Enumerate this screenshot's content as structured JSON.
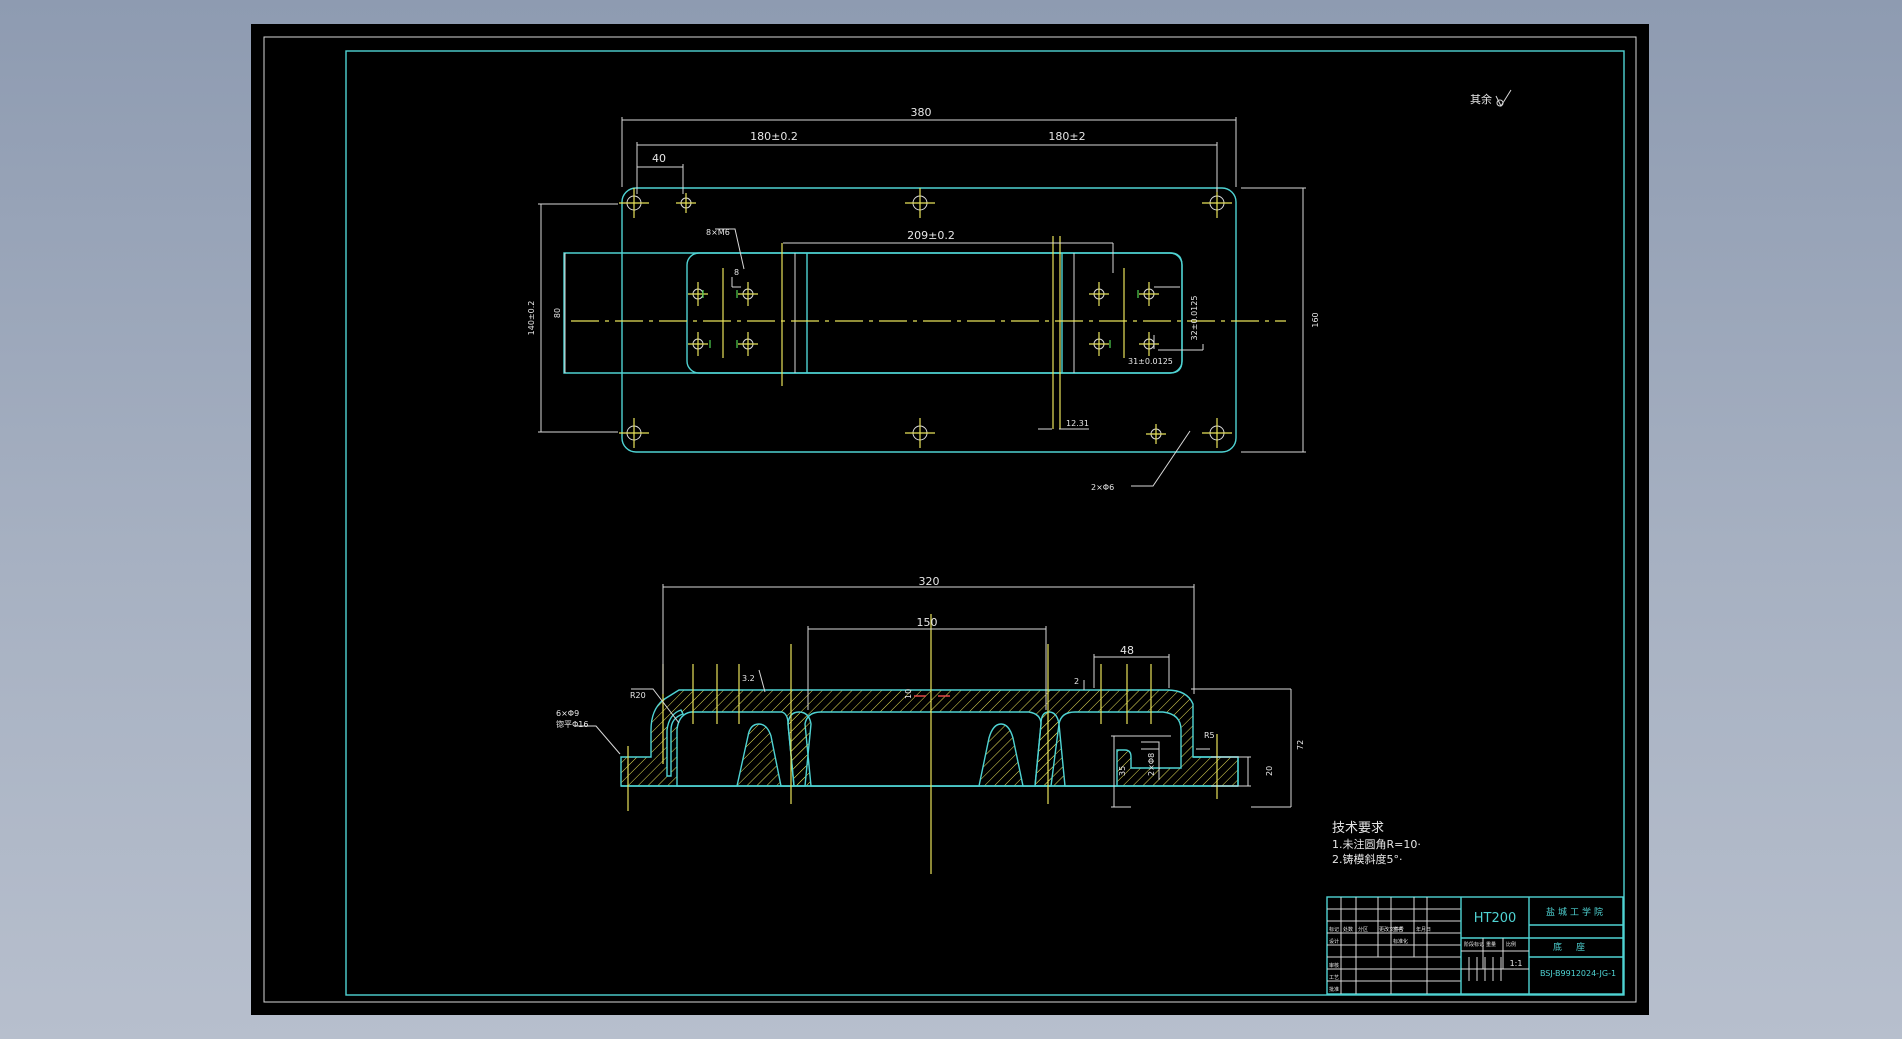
{
  "drawing": {
    "roughness_note": "其余",
    "top_view": {
      "overall_length": "380",
      "half_span_left": "180±0.2",
      "half_span_right": "180±2",
      "hole_offset": "40",
      "slot_span": "209±0.2",
      "thread_callout": "8×M6",
      "small_dim": "8",
      "overall_height": "140±0.2",
      "inner_height": "80",
      "total_height": "160",
      "vertical_spacing": "32±0.0125",
      "horizontal_spacing": "31±0.0125",
      "slot_width": "12.31",
      "pin_hole_callout": "2×Φ6"
    },
    "section_view": {
      "overall_length": "320",
      "inner_length": "150",
      "right_offset": "48",
      "radius_left": "R20",
      "surface_mark": "3.2",
      "thickness": "10",
      "step": "2",
      "counterbore_line1": "6×Φ9",
      "counterbore_line2": "锪平Φ16",
      "drill_callout": "2×Φ8",
      "radius_right": "R5",
      "height": "72",
      "base_height": "20",
      "depth": "35"
    },
    "tech_requirements": {
      "title": "技术要求",
      "item1": "1.未注圆角R=10·",
      "item2": "2.铸模斜度5°·"
    },
    "title_block": {
      "material": "HT200",
      "school": "盐城工学院",
      "part_name": "底座",
      "drawing_number": "BSJ-B9912024-JG-1",
      "scale": "1:1",
      "row_labels": [
        "标记",
        "处数",
        "分区",
        "更改文件号",
        "签名",
        "年月日",
        "设计",
        "标准化",
        "阶段标记",
        "重量",
        "比例",
        "审核",
        "工艺",
        "批准"
      ]
    }
  }
}
